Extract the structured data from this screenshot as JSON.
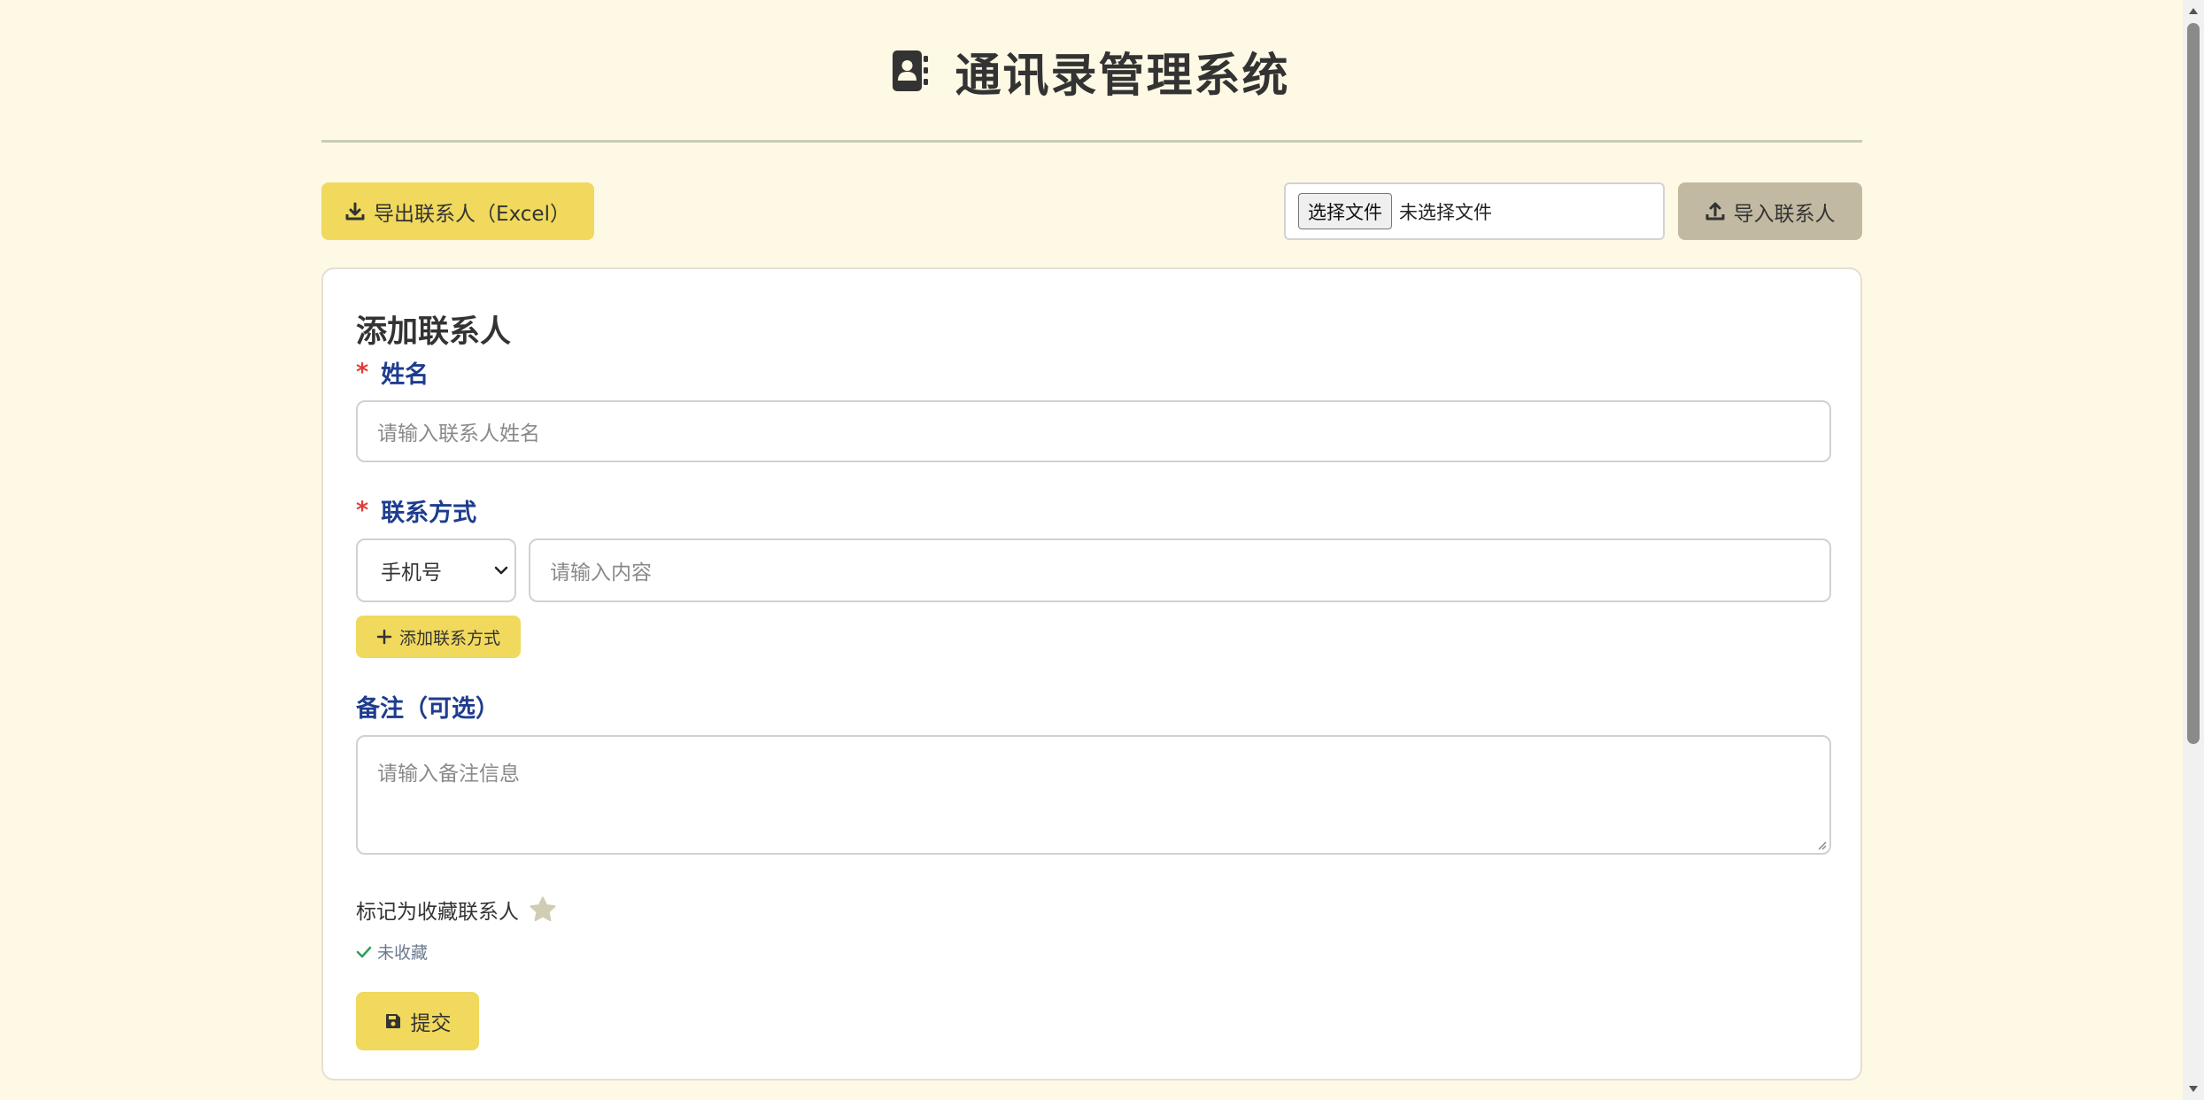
{
  "header": {
    "title": "通讯录管理系统",
    "icon": "address-book-icon"
  },
  "toolbar": {
    "export_label": "导出联系人（Excel）",
    "export_icon": "download-icon",
    "file_button_label": "选择文件",
    "file_status": "未选择文件",
    "import_label": "导入联系人",
    "import_icon": "upload-icon"
  },
  "form": {
    "title": "添加联系人",
    "required_mark": "*",
    "name_label": "姓名",
    "name_placeholder": "请输入联系人姓名",
    "contact_label": "联系方式",
    "contact_type_selected": "手机号",
    "contact_placeholder": "请输入内容",
    "add_contact_label": "添加联系方式",
    "note_label": "备注（可选）",
    "note_placeholder": "请输入备注信息",
    "favorite_label": "标记为收藏联系人",
    "favorite_status": "未收藏",
    "submit_label": "提交"
  },
  "colors": {
    "background": "#fef9e4",
    "accent_yellow": "#f0d95c",
    "import_button": "#c2b9a2",
    "label_blue": "#1e3d8f",
    "required_red": "#e03b3b",
    "status_green": "#2e9e5b"
  }
}
